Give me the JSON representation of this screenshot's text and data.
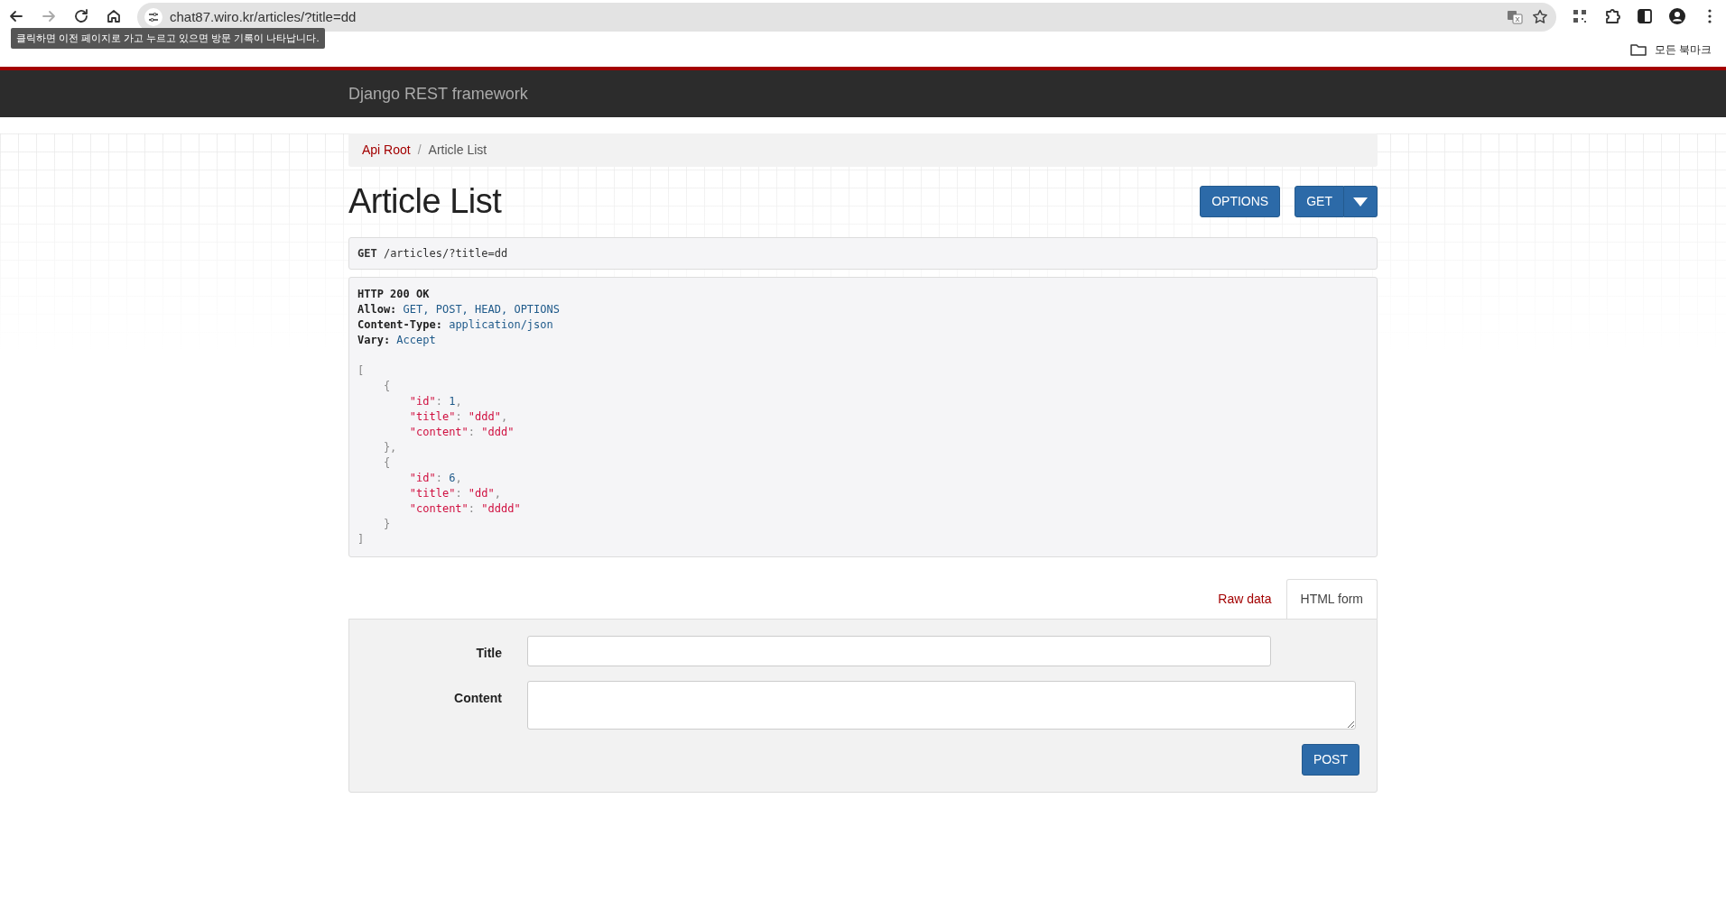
{
  "browser": {
    "url": "chat87.wiro.kr/articles/?title=dd",
    "tooltip": "클릭하면 이전 페이지로 가고 누르고 있으면 방문 기록이 나타납니다.",
    "bookmarks": "모든 북마크"
  },
  "navbar": {
    "brand": "Django REST framework"
  },
  "breadcrumb_separator": "/",
  "breadcrumb": [
    {
      "label": "Api Root",
      "selected": false
    },
    {
      "label": "Article List",
      "selected": true
    }
  ],
  "page_title": "Article List",
  "actions": [
    {
      "label": "OPTIONS",
      "kind": "button"
    },
    {
      "label": "GET",
      "kind": "split"
    }
  ],
  "request": {
    "method": "GET",
    "path": "/articles/?title=dd"
  },
  "response": {
    "status": "HTTP 200 OK",
    "headers": [
      {
        "name": "Allow:",
        "value": "GET, POST, HEAD, OPTIONS"
      },
      {
        "name": "Content-Type:",
        "value": "application/json"
      },
      {
        "name": "Vary:",
        "value": "Accept"
      }
    ],
    "body_lines": [
      "[",
      "    {",
      "        \"id\": 1,",
      "        \"title\": \"ddd\",",
      "        \"content\": \"ddd\"",
      "    },",
      "    {",
      "        \"id\": 6,",
      "        \"title\": \"dd\",",
      "        \"content\": \"dddd\"",
      "    }",
      "]"
    ]
  },
  "form_tabs": [
    {
      "label": "Raw data",
      "selected": false
    },
    {
      "label": "HTML form",
      "selected": true
    }
  ],
  "form": {
    "fields": [
      {
        "label": "Title",
        "kind": "input"
      },
      {
        "label": "Content",
        "kind": "textarea"
      }
    ],
    "submit": "POST"
  }
}
